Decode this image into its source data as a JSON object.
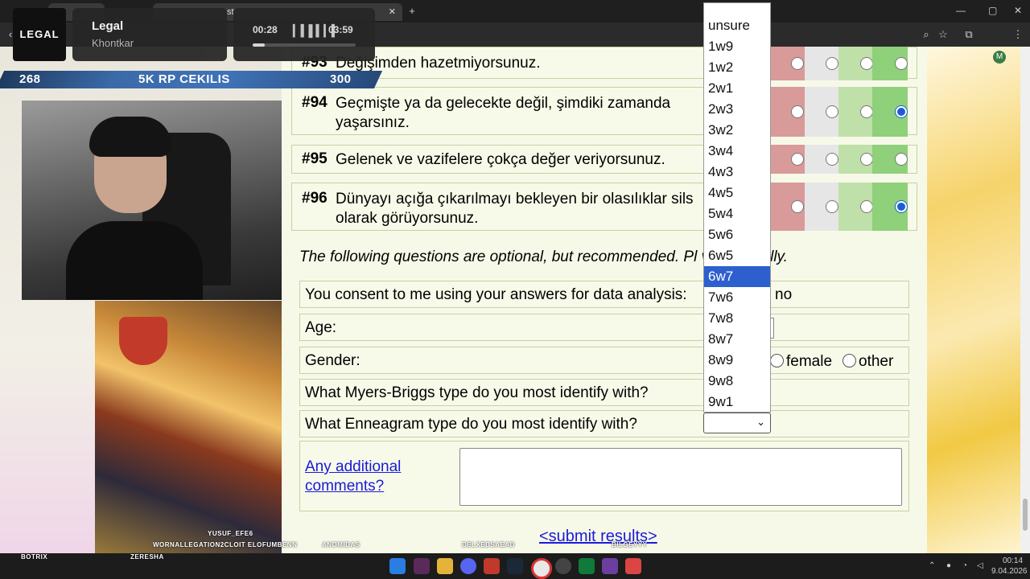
{
  "browser": {
    "tabs": [
      "ik",
      "st"
    ],
    "new_tab": "+"
  },
  "overlay": {
    "logo": "LEGAL",
    "now_playing": {
      "title": "Legal",
      "artist": "Khontkar"
    },
    "player": {
      "elapsed": "00:28",
      "duration": "03:59",
      "progress": 0.12
    },
    "bar": {
      "left": "268",
      "center": "5K RP CEKILIS",
      "right": "300"
    }
  },
  "questions": [
    {
      "num": "#93",
      "text": "Değişimden hazetmiyorsunuz.",
      "selected": -1
    },
    {
      "num": "#94",
      "text": "Geçmişte ya da gelecekte değil, şimdiki zamanda yaşarsınız.",
      "selected": 3
    },
    {
      "num": "#95",
      "text": "Gelenek ve vazifelere çokça değer veriyorsunuz.",
      "selected": -1
    },
    {
      "num": "#96",
      "text": "Dünyayı açığa çıkarılmayı bekleyen bir olasılıklar sils olarak görüyorsunuz.",
      "selected": 3
    }
  ],
  "rating_colors": [
    "#d99a9a",
    "#e6e6e6",
    "#bfe0a8",
    "#8fd07a"
  ],
  "optional_note": "The following questions are optional, but recommended. Pl                  ver truthfully.",
  "form": {
    "consent_label": "You consent to me using your answers for data analysis:",
    "consent_no": "no",
    "age_label": "Age:",
    "gender_label": "Gender:",
    "gender_female": "female",
    "gender_other": "other",
    "mbti_label": "What Myers-Briggs type do you most identify with?",
    "enneagram_label": "What Enneagram type do you most identify with?",
    "comments_link": "Any additional comments?",
    "submit": "<submit results>"
  },
  "dropdown": {
    "options": [
      "unsure",
      "1w9",
      "1w2",
      "2w1",
      "2w3",
      "3w2",
      "3w4",
      "4w3",
      "4w5",
      "5w4",
      "5w6",
      "6w5",
      "6w7",
      "7w6",
      "7w8",
      "8w7",
      "8w9",
      "9w8",
      "9w1"
    ],
    "highlighted": "6w7",
    "selected_value": ""
  },
  "taskbar": {
    "names": [
      "BOTRIX",
      "ZERESHA",
      "YUSUF_EFE6",
      "WORNALLEGATION2CLOIT ELOFUMBENN",
      "ANOMIDAS",
      "DELXEDSAEAD",
      "BILGEYYY"
    ],
    "time": "00:14",
    "date": "9.04.2026"
  }
}
